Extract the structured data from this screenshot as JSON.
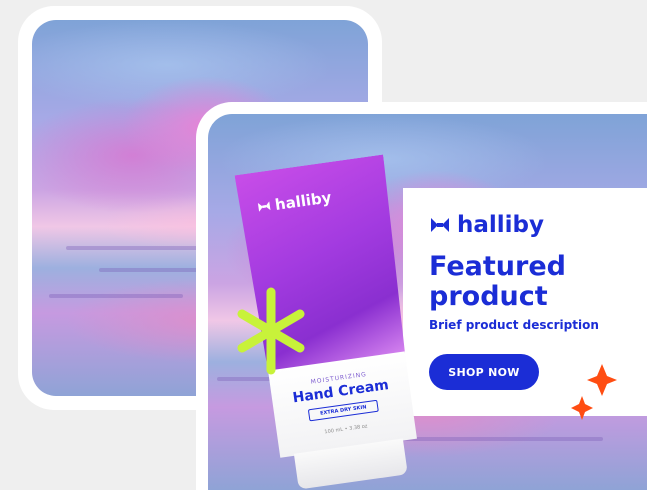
{
  "ad": {
    "brand": "halliby",
    "headline": "Featured product",
    "description": "Brief product description",
    "cta": "SHOP NOW"
  },
  "product": {
    "brand": "halliby",
    "tagline": "MOISTURIZING",
    "name": "Hand Cream",
    "badge": "EXTRA DRY SKIN",
    "size": "100 mL • 3.38 oz"
  },
  "colors": {
    "brand_blue": "#1b2dd6",
    "tube_purple": "#a33be0",
    "accent_lime": "#c8f23a",
    "accent_orange": "#ff4d12"
  },
  "icons": {
    "brand_mark": "halliby-logo-mark",
    "decor_1": "lime-asterisk",
    "decor_2": "orange-sparkles"
  }
}
